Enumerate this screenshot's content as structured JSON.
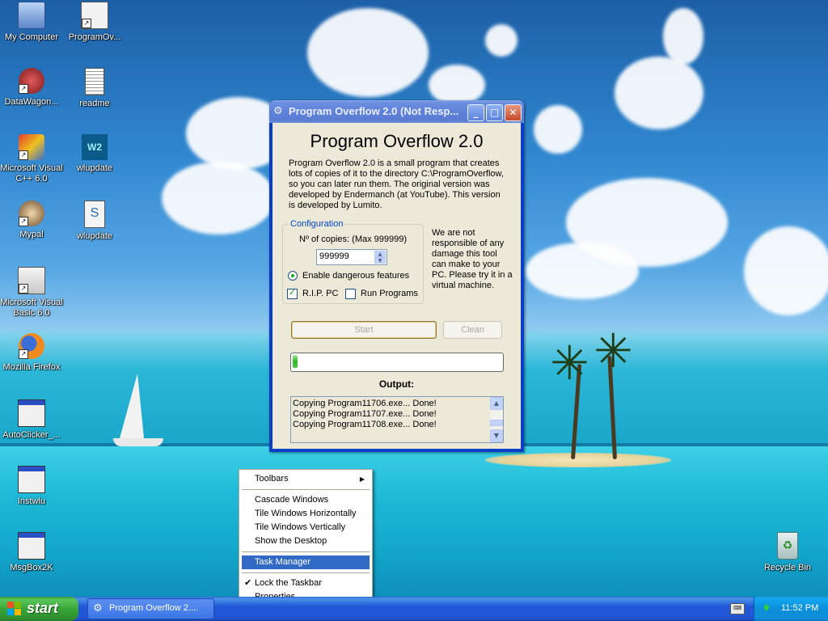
{
  "desktop": {
    "icons": [
      {
        "label": "My Computer",
        "icon": "my-computer-icon"
      },
      {
        "label": "ProgramOv...",
        "icon": "program-overflow-icon"
      },
      {
        "label": "DataWagon...",
        "icon": "datawagon-icon"
      },
      {
        "label": "readme",
        "icon": "text-document-icon"
      },
      {
        "label": "Microsoft Visual C++ 6.0",
        "icon": "visual-cpp-icon"
      },
      {
        "label": "wlupdate",
        "icon": "win2000-icon"
      },
      {
        "label": "Mypal",
        "icon": "mypal-browser-icon"
      },
      {
        "label": "wlupdate",
        "icon": "script-file-icon"
      },
      {
        "label": "Microsoft Visual Basic 6.0",
        "icon": "visual-basic-icon"
      },
      {
        "label": "Mozilla Firefox",
        "icon": "firefox-icon"
      },
      {
        "label": "AutoClicker_...",
        "icon": "application-window-icon"
      },
      {
        "label": "Instwlu",
        "icon": "installer-icon"
      },
      {
        "label": "MsgBox2K",
        "icon": "application-window-icon"
      },
      {
        "label": "Recycle Bin",
        "icon": "recycle-bin-icon"
      }
    ]
  },
  "window": {
    "title": "Program Overflow 2.0 (Not Resp...",
    "heading": "Program Overflow 2.0",
    "description": "Program Overflow 2.0 is a small program that creates lots of copies of it to the directory C:\\ProgramOverflow, so you can later run them. The original version was developed by Endermanch (at YouTube). This version is developed by Lumito.",
    "config": {
      "legend": "Configuration",
      "copies_label": "Nº of copies: (Max 999999)",
      "copies_value": "999999",
      "dangerous_label": "Enable dangerous features",
      "rip_label": "R.I.P. PC",
      "rip_checked": true,
      "run_label": "Run Programs",
      "run_checked": false
    },
    "disclaimer": "We are not responsible of any damage this tool can make to your PC. Please try it in a virtual machine.",
    "start_label": "Start",
    "clean_label": "Clean",
    "progress_fraction": 0.02,
    "output_label": "Output:",
    "output_lines": [
      "Copying Program11706.exe... Done!",
      "Copying Program11707.exe... Done!",
      "Copying Program11708.exe... Done!"
    ]
  },
  "context_menu": {
    "toolbars": "Toolbars",
    "cascade": "Cascade Windows",
    "tile_h": "Tile Windows Horizontally",
    "tile_v": "Tile Windows Vertically",
    "show_desktop": "Show the Desktop",
    "task_manager": "Task Manager",
    "lock_taskbar": "Lock the Taskbar",
    "properties": "Properties",
    "selected": "Task Manager"
  },
  "taskbar": {
    "start_label": "start",
    "task_button_label": "Program Overflow 2....",
    "clock": "11:52 PM"
  },
  "colors": {
    "titlebar": "#5f82d8",
    "menu_selection": "#316ac5",
    "progress_green": "#2fb52b",
    "taskbar_blue": "#2157d7",
    "start_green": "#37a637"
  }
}
